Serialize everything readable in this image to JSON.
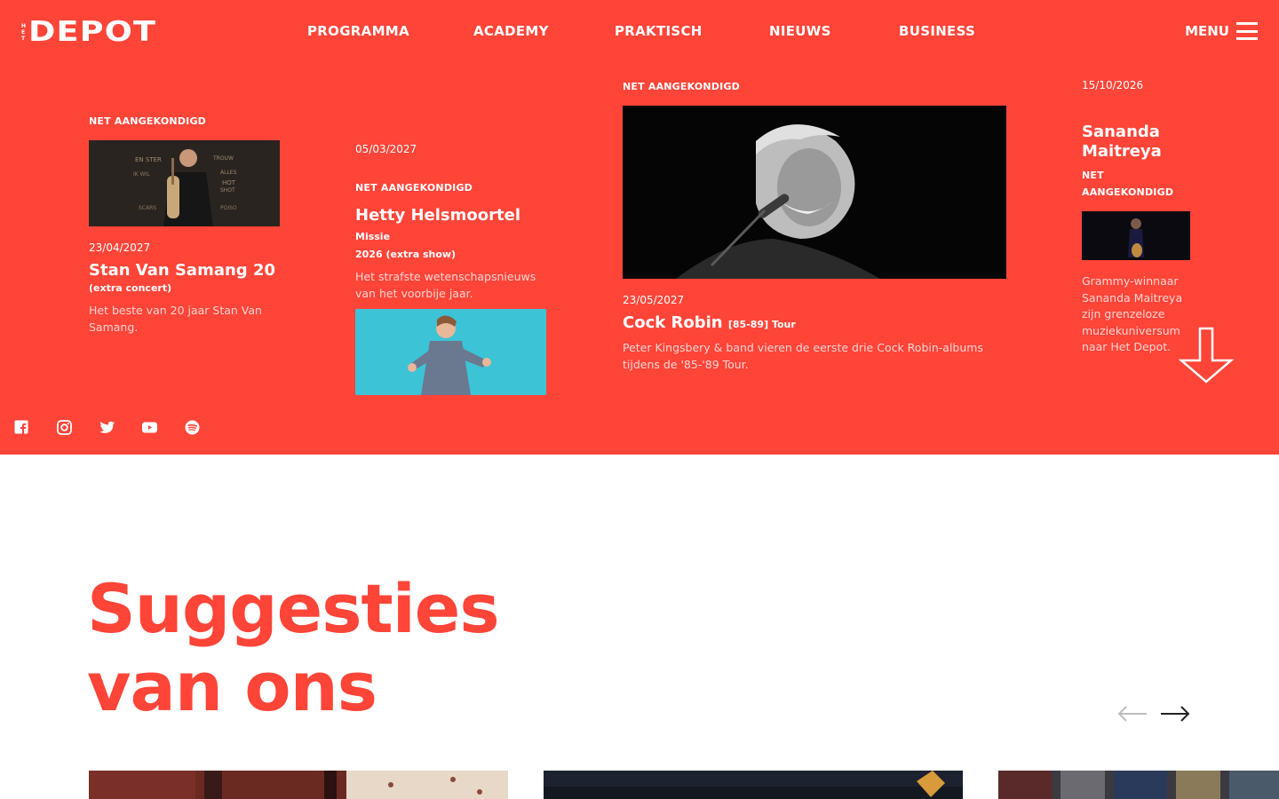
{
  "brand": {
    "logo_small": "HET",
    "logo_main": "DEPOT",
    "accent": "#ff4438"
  },
  "nav": {
    "items": [
      "PROGRAMMA",
      "ACADEMY",
      "PRAKTISCH",
      "NIEUWS",
      "BUSINESS"
    ],
    "menu_label": "MENU"
  },
  "events": [
    {
      "tag": "NET AANGEKONDIGD",
      "date": "23/04/2027",
      "title": "Stan Van Samang 20",
      "subtitle": "(extra concert)",
      "description": "Het beste van 20 jaar Stan Van Samang."
    },
    {
      "date": "05/03/2027",
      "tag": "NET AANGEKONDIGD",
      "title": "Hetty Helsmoortel",
      "title_suffix": "Missie",
      "subtitle": "2026 (extra show)",
      "description": "Het strafste wetenschapsnieuws van het voorbije jaar."
    },
    {
      "tag": "NET AANGEKONDIGD",
      "date": "23/05/2027",
      "title": "Cock Robin",
      "title_suffix": "[85-89] Tour",
      "description": "Peter Kingsbery & band vieren de eerste drie Cock Robin-albums tijdens de '85-'89 Tour."
    },
    {
      "date": "15/10/2026",
      "title": "Sananda Maitreya",
      "tag": "NET AANGEKONDIGD",
      "description": "Grammy-winnaar Sananda Maitreya zijn grenzeloze muziekuniversum naar Het Depot."
    }
  ],
  "socials": [
    "facebook-icon",
    "instagram-icon",
    "twitter-icon",
    "youtube-icon",
    "spotify-icon"
  ],
  "suggestions": {
    "heading_line1": "Suggesties",
    "heading_line2": "van ons"
  }
}
